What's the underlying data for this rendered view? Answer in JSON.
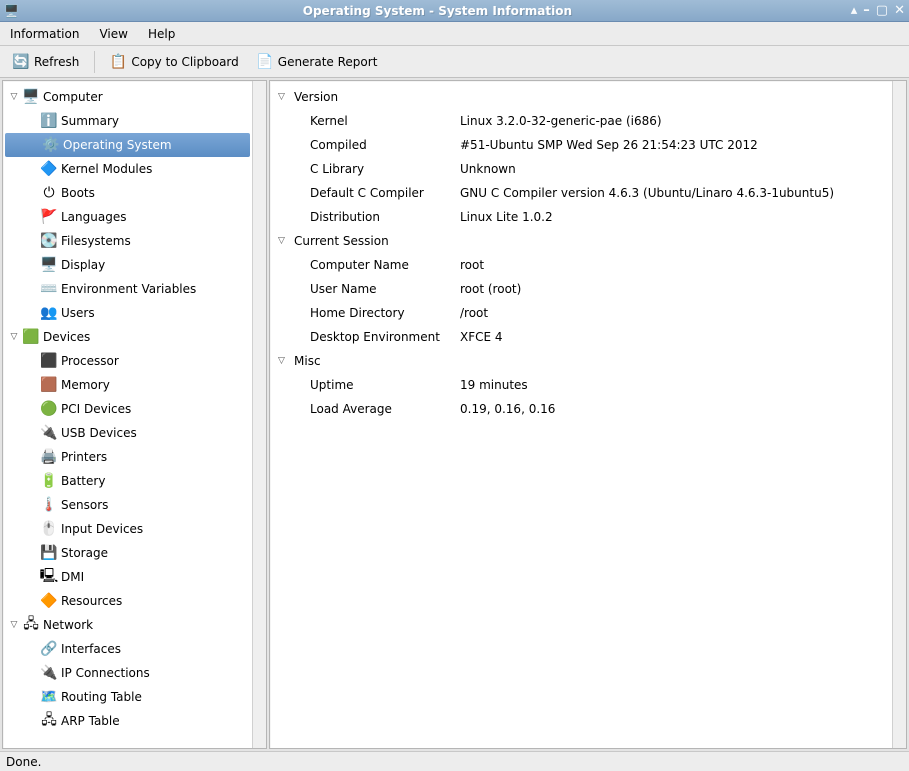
{
  "window": {
    "title": "Operating System - System Information"
  },
  "menu": {
    "information": "Information",
    "view": "View",
    "help": "Help"
  },
  "toolbar": {
    "refresh": "Refresh",
    "copy": "Copy to Clipboard",
    "report": "Generate Report"
  },
  "tree": {
    "computer": "Computer",
    "summary": "Summary",
    "os": "Operating System",
    "kernel_modules": "Kernel Modules",
    "boots": "Boots",
    "languages": "Languages",
    "filesystems": "Filesystems",
    "display": "Display",
    "env": "Environment Variables",
    "users": "Users",
    "devices": "Devices",
    "processor": "Processor",
    "memory": "Memory",
    "pci": "PCI Devices",
    "usb": "USB Devices",
    "printers": "Printers",
    "battery": "Battery",
    "sensors": "Sensors",
    "input": "Input Devices",
    "storage": "Storage",
    "dmi": "DMI",
    "resources": "Resources",
    "network": "Network",
    "interfaces": "Interfaces",
    "ip": "IP Connections",
    "routing": "Routing Table",
    "arp": "ARP Table"
  },
  "details": {
    "version": {
      "title": "Version",
      "kernel_k": "Kernel",
      "kernel_v": "Linux 3.2.0-32-generic-pae (i686)",
      "compiled_k": "Compiled",
      "compiled_v": "#51-Ubuntu SMP Wed Sep 26 21:54:23 UTC 2012",
      "clib_k": "C Library",
      "clib_v": "Unknown",
      "cc_k": "Default C Compiler",
      "cc_v": "GNU C Compiler version 4.6.3 (Ubuntu/Linaro 4.6.3-1ubuntu5)",
      "dist_k": "Distribution",
      "dist_v": "Linux Lite 1.0.2"
    },
    "session": {
      "title": "Current Session",
      "host_k": "Computer Name",
      "host_v": "root",
      "user_k": "User Name",
      "user_v": "root (root)",
      "home_k": "Home Directory",
      "home_v": "/root",
      "de_k": "Desktop Environment",
      "de_v": "XFCE 4"
    },
    "misc": {
      "title": "Misc",
      "uptime_k": "Uptime",
      "uptime_v": "19 minutes",
      "load_k": "Load Average",
      "load_v": "0.19, 0.16, 0.16"
    }
  },
  "status": "Done."
}
